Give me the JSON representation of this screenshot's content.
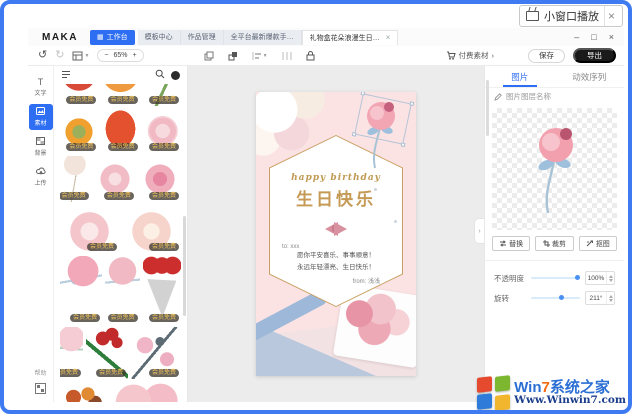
{
  "toast": {
    "label": "小窗口播放",
    "close": "×"
  },
  "titlebar": {
    "logo": "MAKA",
    "tabs": [
      {
        "label": "工作台",
        "active": true
      },
      {
        "label": "模板中心"
      },
      {
        "label": "作品管理"
      },
      {
        "label": "全平台最新爆款手…"
      },
      {
        "label": "礼物盒花朵浪漫生日…",
        "close": "×"
      }
    ],
    "window_controls": {
      "minimize": "–",
      "maximize": "□",
      "close": "×"
    }
  },
  "toolbar": {
    "undo": "↺",
    "redo": "↻",
    "zoom_minus": "−",
    "zoom_value": "65%",
    "zoom_plus": "+",
    "paid_label": "付费素材",
    "paid_arrow": "›",
    "save_label": "保存",
    "export_label": "导出"
  },
  "sidebar": {
    "items": [
      {
        "label": "文字",
        "glyph": "T"
      },
      {
        "label": "素材",
        "active": true
      },
      {
        "label": "背景"
      },
      {
        "label": "上传"
      }
    ],
    "help_label": "帮助"
  },
  "stickers": {
    "items": [
      {
        "name": "red-flower",
        "badge": "会员免费"
      },
      {
        "name": "orange-flower",
        "badge": "会员免费"
      },
      {
        "name": "leaf-stem",
        "badge": "会员免费"
      },
      {
        "name": "sunflower",
        "badge": "会员免费"
      },
      {
        "name": "orange-poppy",
        "badge": "会员免费"
      },
      {
        "name": "pink-rose",
        "badge": "会员免费"
      },
      {
        "name": "dandelion",
        "badge": "会员免费"
      },
      {
        "name": "blush-rose",
        "badge": "会员免费"
      },
      {
        "name": "deep-pink-rose",
        "badge": "会员免费"
      },
      {
        "name": "large-pink-rose",
        "badge": "会员免费"
      },
      {
        "name": "large-cream-rose",
        "badge": "会员免费"
      },
      {
        "name": "balloon-rose-ribbon",
        "badge": "会员免费"
      },
      {
        "name": "balloon-rose-small",
        "badge": "会员免费"
      },
      {
        "name": "red-tulips-paper",
        "badge": "会员免费"
      },
      {
        "name": "rose-bud",
        "badge": "会员免费"
      },
      {
        "name": "red-rose-bouquet",
        "badge": "会员免费"
      },
      {
        "name": "magnolia-branch",
        "badge": "会员免费"
      },
      {
        "name": "autumn-flowers",
        "badge": "会员免费"
      },
      {
        "name": "pink-peony",
        "badge": "会员免费"
      }
    ]
  },
  "canvas": {
    "card": {
      "title_en": "happy birthday",
      "title_cn": "生日快乐",
      "to_line": "to: xxx",
      "wish_line1": "愿你平安喜乐、事事顺意！",
      "wish_line2": "永远年轻漂亮、生日快乐！",
      "from_line": "from: 浅浅"
    },
    "collapse_arrow": "›"
  },
  "inspector": {
    "tabs": [
      {
        "label": "图片",
        "active": true
      },
      {
        "label": "动效序列"
      }
    ],
    "layer_name": "图片图层名称",
    "buttons": [
      {
        "label": "替换"
      },
      {
        "label": "裁剪"
      },
      {
        "label": "抠图"
      }
    ],
    "opacity": {
      "label": "不透明度",
      "value": "100%",
      "percent": 100
    },
    "rotate": {
      "label": "旋转",
      "value": "211°",
      "percent": 59
    }
  },
  "watermark": {
    "brand_win": "Win",
    "brand_7": "7",
    "brand_rest": "系统之家",
    "url": "Www.Winwin7.com"
  }
}
